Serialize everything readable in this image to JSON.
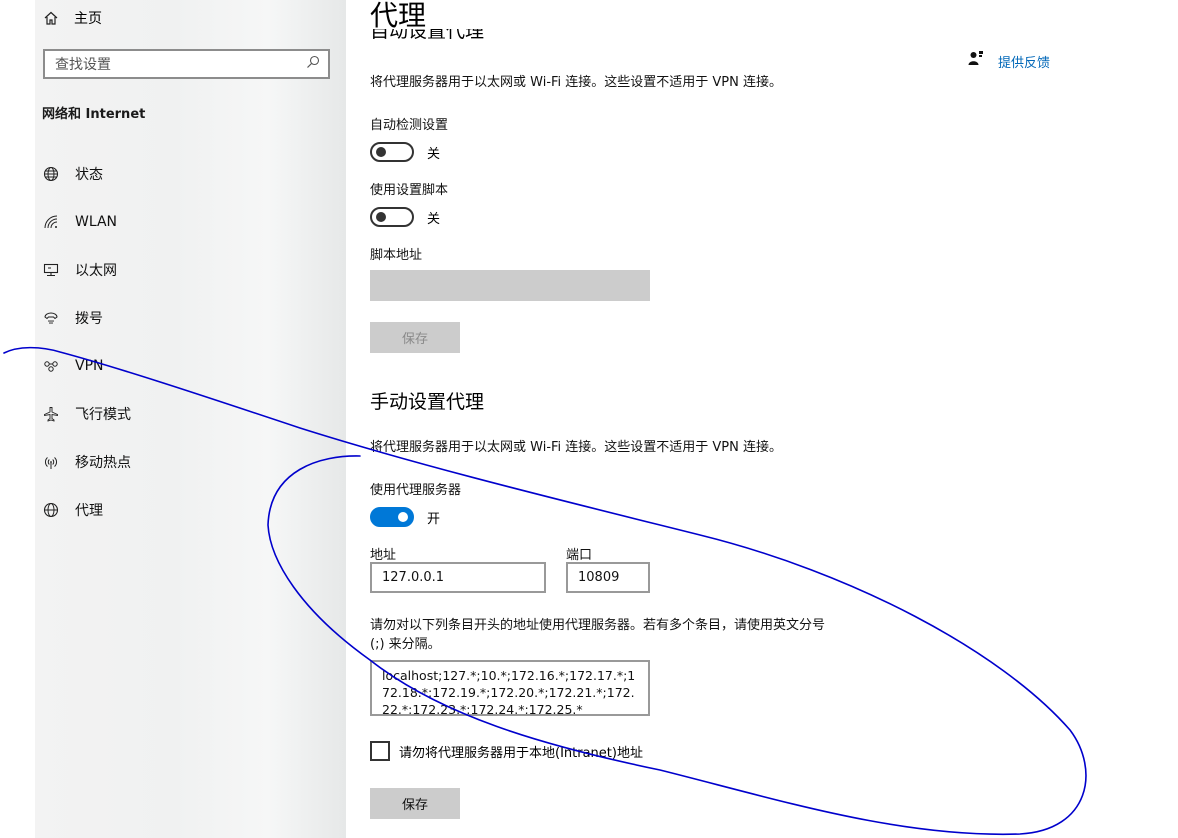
{
  "sidebar": {
    "home_label": "主页",
    "search_placeholder": "查找设置",
    "section_title": "网络和 Internet",
    "items": [
      {
        "label": "状态",
        "icon": "globe-status-icon"
      },
      {
        "label": "WLAN",
        "icon": "wifi-icon"
      },
      {
        "label": "以太网",
        "icon": "ethernet-icon"
      },
      {
        "label": "拨号",
        "icon": "dialup-icon"
      },
      {
        "label": "VPN",
        "icon": "vpn-icon"
      },
      {
        "label": "飞行模式",
        "icon": "airplane-icon"
      },
      {
        "label": "移动热点",
        "icon": "hotspot-icon"
      },
      {
        "label": "代理",
        "icon": "globe-icon"
      }
    ]
  },
  "main": {
    "page_title": "代理",
    "feedback_label": "提供反馈",
    "auto": {
      "heading": "自动设置代理",
      "description": "将代理服务器用于以太网或 Wi-Fi 连接。这些设置不适用于 VPN 连接。",
      "auto_detect_label": "自动检测设置",
      "auto_detect_state": "关",
      "use_script_label": "使用设置脚本",
      "use_script_state": "关",
      "script_address_label": "脚本地址",
      "script_address_value": "",
      "save_label": "保存"
    },
    "manual": {
      "heading": "手动设置代理",
      "description": "将代理服务器用于以太网或 Wi-Fi 连接。这些设置不适用于 VPN 连接。",
      "use_proxy_label": "使用代理服务器",
      "use_proxy_state": "开",
      "address_label": "地址",
      "address_value": "127.0.0.1",
      "port_label": "端口",
      "port_value": "10809",
      "exceptions_description": "请勿对以下列条目开头的地址使用代理服务器。若有多个条目，请使用英文分号 (;) 来分隔。",
      "exceptions_value": "localhost;127.*;10.*;172.16.*;172.17.*;172.18.*;172.19.*;172.20.*;172.21.*;172.22.*;172.23.*;172.24.*;172.25.*",
      "bypass_local_label": "请勿将代理服务器用于本地(Intranet)地址",
      "bypass_local_checked": false,
      "save_label": "保存"
    }
  },
  "colors": {
    "accent": "#0078d7",
    "link": "#0067b8",
    "annotation_ink": "#0000cc"
  }
}
